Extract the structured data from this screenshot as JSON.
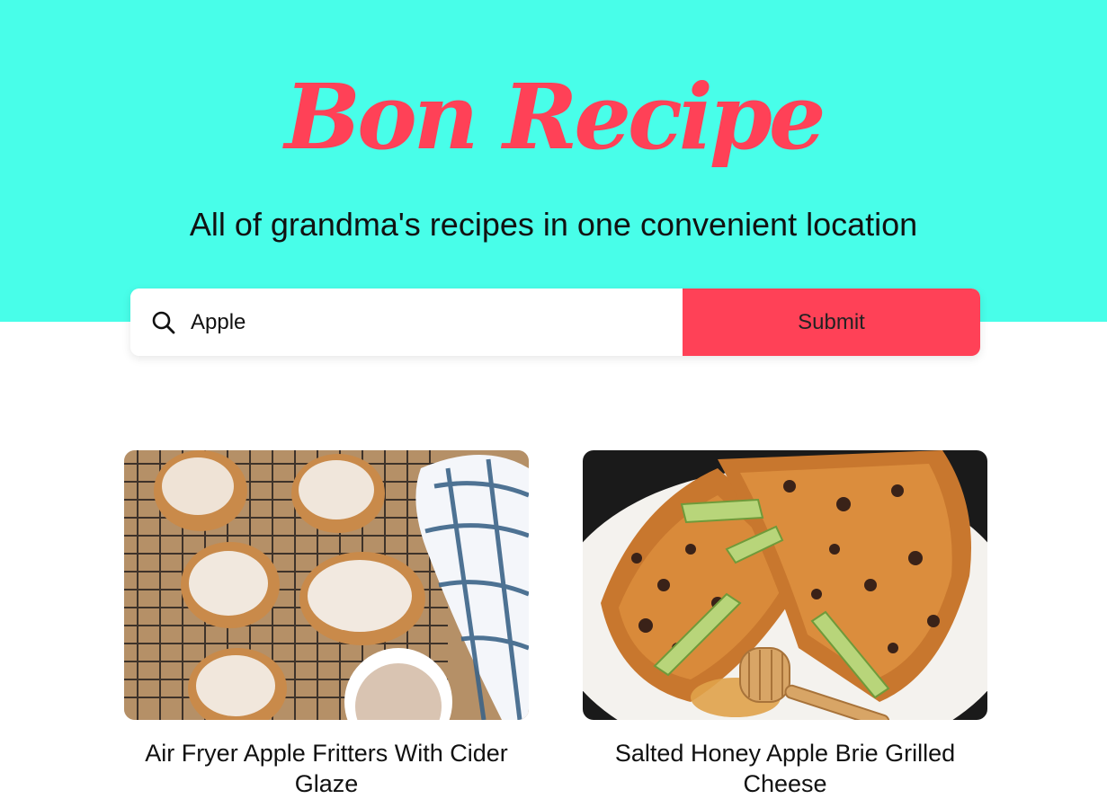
{
  "header": {
    "logo_text": "Bon Recipe",
    "tagline": "All of grandma's recipes in one convenient location"
  },
  "search": {
    "icon": "search-icon",
    "value": "Apple",
    "submit_label": "Submit"
  },
  "recipes": [
    {
      "title": "Air Fryer Apple Fritters With Cider Glaze",
      "image": "apple-fritters-photo"
    },
    {
      "title": "Salted Honey Apple Brie Grilled Cheese",
      "image": "grilled-cheese-photo"
    }
  ],
  "colors": {
    "hero_bg": "#48fee9",
    "brand_red": "#ff4157",
    "page_bg": "#ffffff"
  }
}
